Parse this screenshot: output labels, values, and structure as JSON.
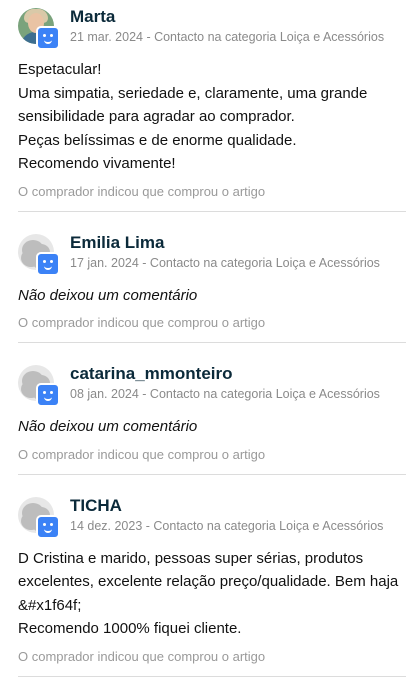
{
  "reviews": [
    {
      "name": "Marta",
      "subtitle": "21 mar. 2024 - Contacto na categoria Loiça e Acessórios",
      "comment": "Espetacular!\nUma simpatia, seriedade e, claramente, uma grande sensibilidade para agradar ao comprador.\nPeças belíssimas e de enorme qualidade.\nRecomendo vivamente!",
      "note": "O comprador indicou que comprou o artigo"
    },
    {
      "name": "Emilia Lima",
      "subtitle": "17 jan. 2024 - Contacto na categoria Loiça e Acessórios",
      "comment": "Não deixou um comentário",
      "note": "O comprador indicou que comprou o artigo"
    },
    {
      "name": "catarina_mmonteiro",
      "subtitle": "08 jan. 2024 - Contacto na categoria Loiça e Acessórios",
      "comment": "Não deixou um comentário",
      "note": "O comprador indicou que comprou o artigo"
    },
    {
      "name": "TICHA",
      "subtitle": "14 dez. 2023 - Contacto na categoria Loiça e Acessórios",
      "comment": "D Cristina e marido,  pessoas super sérias, produtos excelentes, excelente relação preço/qualidade. Bem haja &#x1f64f;\nRecomendo 1000% fiquei cliente.",
      "note": "O comprador indicou que comprou o artigo"
    }
  ],
  "colors": {
    "name": "#0b2a3a",
    "meta": "#8a8a8a",
    "badge": "#3b82f6",
    "divider": "#dcdcdc"
  },
  "icons": {
    "user_avatar": "user-photo",
    "default_avatar": "default-avatar-icon",
    "badge": "bot-badge-icon"
  }
}
